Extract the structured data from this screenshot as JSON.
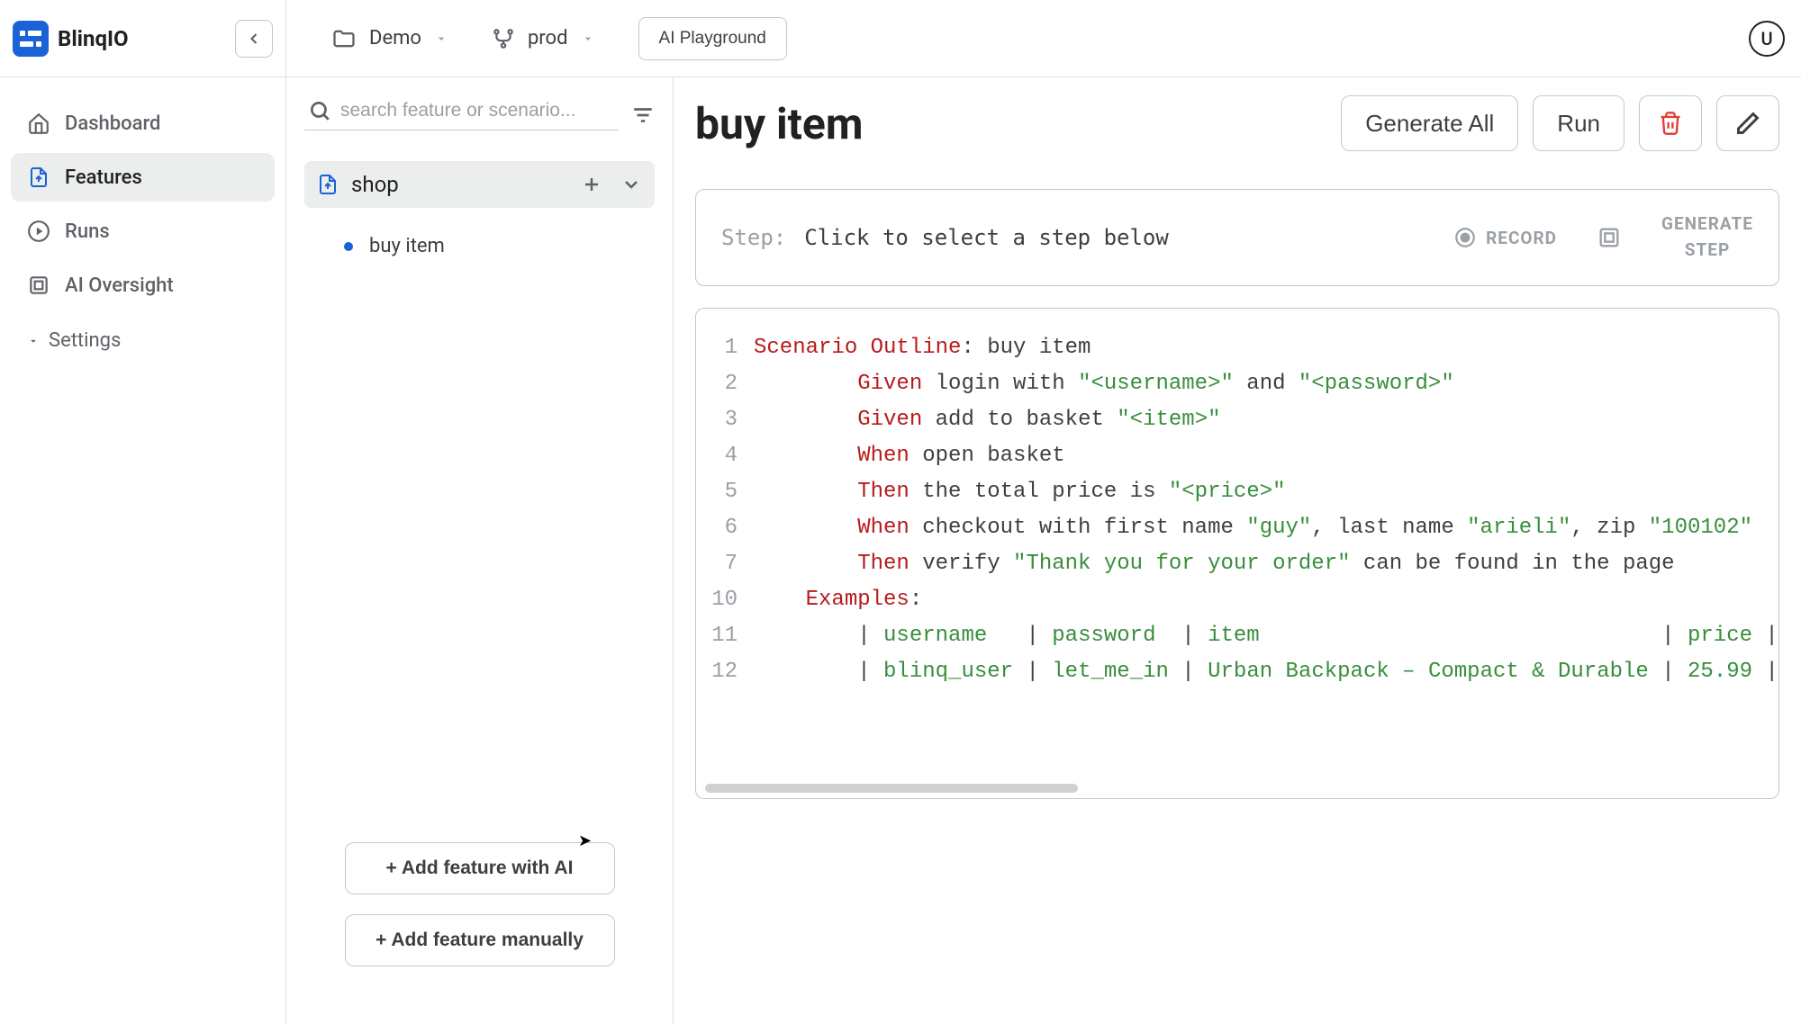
{
  "brand": {
    "name": "BlinqIO"
  },
  "topbar": {
    "project_label": "Demo",
    "env_label": "prod",
    "playground": "AI Playground",
    "avatar_initial": "U"
  },
  "sidebar": {
    "items": [
      {
        "label": "Dashboard"
      },
      {
        "label": "Features"
      },
      {
        "label": "Runs"
      },
      {
        "label": "AI Oversight"
      }
    ],
    "settings_label": "Settings"
  },
  "feature_panel": {
    "search_placeholder": "search feature or scenario...",
    "feature_name": "shop",
    "scenarios": [
      {
        "name": "buy item"
      }
    ],
    "add_ai": "+ Add feature with AI",
    "add_manual": "+ Add feature manually"
  },
  "editor": {
    "title": "buy item",
    "actions": {
      "generate_all": "Generate All",
      "run": "Run"
    },
    "step_bar": {
      "label": "Step:",
      "hint": "Click to select a step below",
      "record": "RECORD",
      "generate_line1": "GENERATE",
      "generate_line2": "STEP"
    },
    "code": {
      "lines": [
        {
          "n": "1",
          "segments": [
            {
              "t": "Scenario Outline",
              "c": "kw-scenario"
            },
            {
              "t": ": buy item"
            }
          ]
        },
        {
          "n": "2",
          "segments": [
            {
              "t": "        "
            },
            {
              "t": "Given",
              "c": "kw-given"
            },
            {
              "t": " login with "
            },
            {
              "t": "\"<username>\"",
              "c": "str"
            },
            {
              "t": " and "
            },
            {
              "t": "\"<password>\"",
              "c": "str"
            }
          ]
        },
        {
          "n": "3",
          "segments": [
            {
              "t": "        "
            },
            {
              "t": "Given",
              "c": "kw-given"
            },
            {
              "t": " add to basket "
            },
            {
              "t": "\"<item>\"",
              "c": "str"
            }
          ]
        },
        {
          "n": "4",
          "segments": [
            {
              "t": "        "
            },
            {
              "t": "When",
              "c": "kw-when"
            },
            {
              "t": " open basket"
            }
          ]
        },
        {
          "n": "5",
          "segments": [
            {
              "t": "        "
            },
            {
              "t": "Then",
              "c": "kw-then"
            },
            {
              "t": " the total price is "
            },
            {
              "t": "\"<price>\"",
              "c": "str"
            }
          ]
        },
        {
          "n": "6",
          "segments": [
            {
              "t": "        "
            },
            {
              "t": "When",
              "c": "kw-when"
            },
            {
              "t": " checkout with first name "
            },
            {
              "t": "\"guy\"",
              "c": "str"
            },
            {
              "t": ", last name "
            },
            {
              "t": "\"arieli\"",
              "c": "str"
            },
            {
              "t": ", zip "
            },
            {
              "t": "\"100102\"",
              "c": "str"
            }
          ]
        },
        {
          "n": "7",
          "segments": [
            {
              "t": "        "
            },
            {
              "t": "Then",
              "c": "kw-then"
            },
            {
              "t": " verify "
            },
            {
              "t": "\"Thank you for your order\"",
              "c": "str"
            },
            {
              "t": " can be found in the page"
            }
          ]
        },
        {
          "n": "10",
          "segments": [
            {
              "t": "    "
            },
            {
              "t": "Examples",
              "c": "kw-examples"
            },
            {
              "t": ":"
            }
          ]
        },
        {
          "n": "11",
          "segments": [
            {
              "t": "        | "
            },
            {
              "t": "username",
              "c": "hdr"
            },
            {
              "t": "   | "
            },
            {
              "t": "password",
              "c": "hdr"
            },
            {
              "t": "  | "
            },
            {
              "t": "item",
              "c": "hdr"
            },
            {
              "t": "                               | "
            },
            {
              "t": "price",
              "c": "hdr"
            },
            {
              "t": " |"
            }
          ]
        },
        {
          "n": "12",
          "segments": [
            {
              "t": "        | "
            },
            {
              "t": "blinq_user",
              "c": "str"
            },
            {
              "t": " | "
            },
            {
              "t": "let_me_in",
              "c": "str"
            },
            {
              "t": " | "
            },
            {
              "t": "Urban Backpack – Compact & Durable",
              "c": "str"
            },
            {
              "t": " | "
            },
            {
              "t": "25.99",
              "c": "str"
            },
            {
              "t": " |"
            }
          ]
        }
      ]
    }
  }
}
